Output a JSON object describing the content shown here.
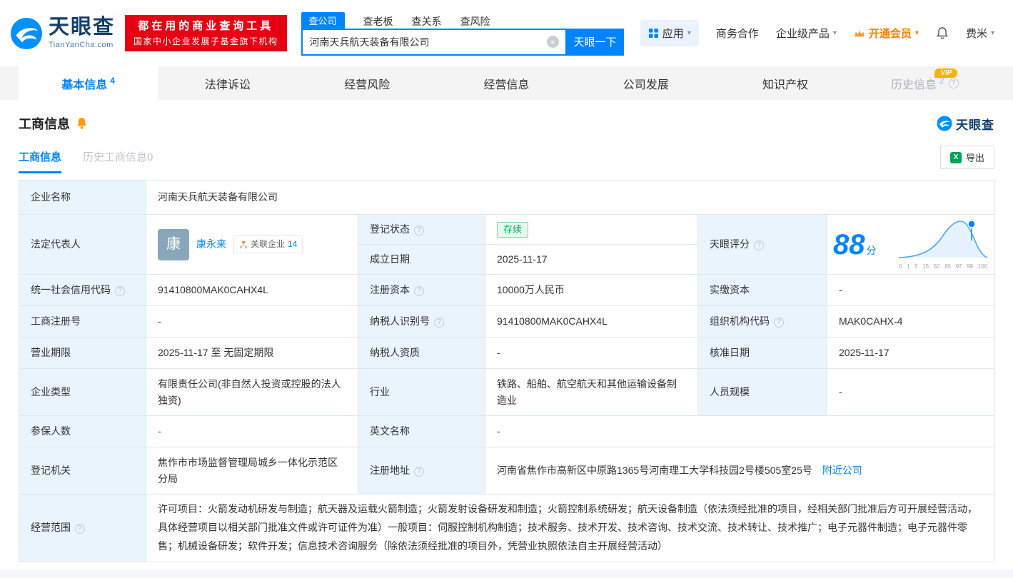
{
  "icons": {
    "help": "?",
    "clear": "×",
    "caret": "▾",
    "excel": "X"
  },
  "header": {
    "logo_brand": "天眼查",
    "logo_domain": "TianYanCha.com",
    "slogan_line1": "都在用的商业查询工具",
    "slogan_line2": "国家中小企业发展子基金旗下机构",
    "search_tabs": [
      "查公司",
      "查老板",
      "查关系",
      "查风险"
    ],
    "search_value": "河南天兵航天装备有限公司",
    "search_button": "天眼一下",
    "menu_apps": "应用",
    "menu_cooperation": "商务合作",
    "menu_enterprise": "企业级产品",
    "menu_vip": "开通会员",
    "menu_user": "费米"
  },
  "nav": {
    "vip_badge": "VIP",
    "tabs": [
      {
        "label": "基本信息",
        "count": "4"
      },
      {
        "label": "法律诉讼"
      },
      {
        "label": "经营风险"
      },
      {
        "label": "经营信息"
      },
      {
        "label": "公司发展"
      },
      {
        "label": "知识产权"
      },
      {
        "label": "历史信息",
        "count": "2"
      }
    ]
  },
  "section": {
    "title": "工商信息",
    "watermark_brand": "天眼查",
    "tab_current": "工商信息",
    "tab_history": "历史工商信息0",
    "export_label": "导出"
  },
  "score": {
    "value": "88",
    "unit": "分",
    "axis": [
      "0",
      "1",
      "5",
      "15",
      "50",
      "85",
      "97",
      "99",
      "100"
    ]
  },
  "table": {
    "labels": {
      "company_name": "企业名称",
      "legal_rep": "法定代表人",
      "reg_status": "登记状态",
      "est_date": "成立日期",
      "score": "天眼评分",
      "credit_code": "统一社会信用代码",
      "reg_capital": "注册资本",
      "paid_capital": "实缴资本",
      "reg_number": "工商注册号",
      "taxpayer_id": "纳税人识别号",
      "org_code": "组织机构代码",
      "business_term": "营业期限",
      "taxpayer_quality": "纳税人资质",
      "approval_date": "核准日期",
      "company_type": "企业类型",
      "industry": "行业",
      "staff_size": "人员规模",
      "insured_count": "参保人数",
      "english_name": "英文名称",
      "reg_authority": "登记机关",
      "reg_address": "注册地址",
      "business_scope": "经营范围"
    },
    "values": {
      "company_name": "河南天兵航天装备有限公司",
      "legal_rep_avatar": "康",
      "legal_rep_name": "康永来",
      "related_label": "关联企业",
      "related_count": "14",
      "reg_status": "存续",
      "est_date": "2025-11-17",
      "credit_code": "91410800MAK0CAHX4L",
      "reg_capital": "10000万人民币",
      "paid_capital": "-",
      "reg_number": "-",
      "taxpayer_id": "91410800MAK0CAHX4L",
      "org_code": "MAK0CAHX-4",
      "business_term": "2025-11-17 至 无固定期限",
      "taxpayer_quality": "-",
      "approval_date": "2025-11-17",
      "company_type": "有限责任公司(非自然人投资或控股的法人独资)",
      "industry": "铁路、船舶、航空航天和其他运输设备制造业",
      "staff_size": "-",
      "insured_count": "-",
      "english_name": "-",
      "reg_authority": "焦作市市场监督管理局城乡一体化示范区分局",
      "reg_address": "河南省焦作市高新区中原路1365号河南理工大学科技园2号楼505室25号",
      "nearby_link": "附近公司",
      "business_scope": "许可项目：火箭发动机研发与制造；航天器及运载火箭制造；火箭发射设备研发和制造；火箭控制系统研发；航天设备制造（依法须经批准的项目，经相关部门批准后方可开展经营活动，具体经营项目以相关部门批准文件或许可证件为准）一般项目：伺服控制机构制造；技术服务、技术开发、技术咨询、技术交流、技术转让、技术推广；电子元器件制造；电子元器件零售；机械设备研发；软件开发；信息技术咨询服务（除依法须经批准的项目外，凭营业执照依法自主开展经营活动）"
    }
  }
}
